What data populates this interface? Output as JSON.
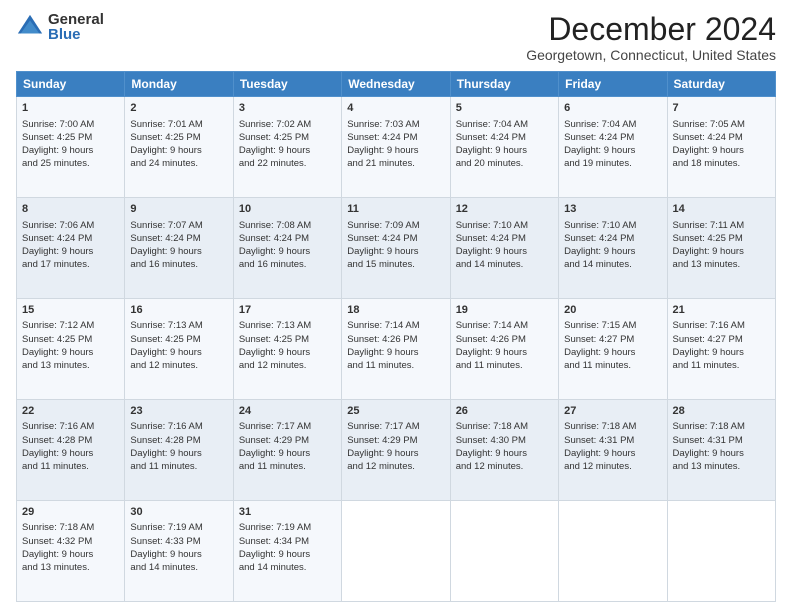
{
  "logo": {
    "general": "General",
    "blue": "Blue"
  },
  "title": "December 2024",
  "subtitle": "Georgetown, Connecticut, United States",
  "headers": [
    "Sunday",
    "Monday",
    "Tuesday",
    "Wednesday",
    "Thursday",
    "Friday",
    "Saturday"
  ],
  "weeks": [
    [
      {
        "day": "1",
        "lines": [
          "Sunrise: 7:00 AM",
          "Sunset: 4:25 PM",
          "Daylight: 9 hours",
          "and 25 minutes."
        ]
      },
      {
        "day": "2",
        "lines": [
          "Sunrise: 7:01 AM",
          "Sunset: 4:25 PM",
          "Daylight: 9 hours",
          "and 24 minutes."
        ]
      },
      {
        "day": "3",
        "lines": [
          "Sunrise: 7:02 AM",
          "Sunset: 4:25 PM",
          "Daylight: 9 hours",
          "and 22 minutes."
        ]
      },
      {
        "day": "4",
        "lines": [
          "Sunrise: 7:03 AM",
          "Sunset: 4:24 PM",
          "Daylight: 9 hours",
          "and 21 minutes."
        ]
      },
      {
        "day": "5",
        "lines": [
          "Sunrise: 7:04 AM",
          "Sunset: 4:24 PM",
          "Daylight: 9 hours",
          "and 20 minutes."
        ]
      },
      {
        "day": "6",
        "lines": [
          "Sunrise: 7:04 AM",
          "Sunset: 4:24 PM",
          "Daylight: 9 hours",
          "and 19 minutes."
        ]
      },
      {
        "day": "7",
        "lines": [
          "Sunrise: 7:05 AM",
          "Sunset: 4:24 PM",
          "Daylight: 9 hours",
          "and 18 minutes."
        ]
      }
    ],
    [
      {
        "day": "8",
        "lines": [
          "Sunrise: 7:06 AM",
          "Sunset: 4:24 PM",
          "Daylight: 9 hours",
          "and 17 minutes."
        ]
      },
      {
        "day": "9",
        "lines": [
          "Sunrise: 7:07 AM",
          "Sunset: 4:24 PM",
          "Daylight: 9 hours",
          "and 16 minutes."
        ]
      },
      {
        "day": "10",
        "lines": [
          "Sunrise: 7:08 AM",
          "Sunset: 4:24 PM",
          "Daylight: 9 hours",
          "and 16 minutes."
        ]
      },
      {
        "day": "11",
        "lines": [
          "Sunrise: 7:09 AM",
          "Sunset: 4:24 PM",
          "Daylight: 9 hours",
          "and 15 minutes."
        ]
      },
      {
        "day": "12",
        "lines": [
          "Sunrise: 7:10 AM",
          "Sunset: 4:24 PM",
          "Daylight: 9 hours",
          "and 14 minutes."
        ]
      },
      {
        "day": "13",
        "lines": [
          "Sunrise: 7:10 AM",
          "Sunset: 4:24 PM",
          "Daylight: 9 hours",
          "and 14 minutes."
        ]
      },
      {
        "day": "14",
        "lines": [
          "Sunrise: 7:11 AM",
          "Sunset: 4:25 PM",
          "Daylight: 9 hours",
          "and 13 minutes."
        ]
      }
    ],
    [
      {
        "day": "15",
        "lines": [
          "Sunrise: 7:12 AM",
          "Sunset: 4:25 PM",
          "Daylight: 9 hours",
          "and 13 minutes."
        ]
      },
      {
        "day": "16",
        "lines": [
          "Sunrise: 7:13 AM",
          "Sunset: 4:25 PM",
          "Daylight: 9 hours",
          "and 12 minutes."
        ]
      },
      {
        "day": "17",
        "lines": [
          "Sunrise: 7:13 AM",
          "Sunset: 4:25 PM",
          "Daylight: 9 hours",
          "and 12 minutes."
        ]
      },
      {
        "day": "18",
        "lines": [
          "Sunrise: 7:14 AM",
          "Sunset: 4:26 PM",
          "Daylight: 9 hours",
          "and 11 minutes."
        ]
      },
      {
        "day": "19",
        "lines": [
          "Sunrise: 7:14 AM",
          "Sunset: 4:26 PM",
          "Daylight: 9 hours",
          "and 11 minutes."
        ]
      },
      {
        "day": "20",
        "lines": [
          "Sunrise: 7:15 AM",
          "Sunset: 4:27 PM",
          "Daylight: 9 hours",
          "and 11 minutes."
        ]
      },
      {
        "day": "21",
        "lines": [
          "Sunrise: 7:16 AM",
          "Sunset: 4:27 PM",
          "Daylight: 9 hours",
          "and 11 minutes."
        ]
      }
    ],
    [
      {
        "day": "22",
        "lines": [
          "Sunrise: 7:16 AM",
          "Sunset: 4:28 PM",
          "Daylight: 9 hours",
          "and 11 minutes."
        ]
      },
      {
        "day": "23",
        "lines": [
          "Sunrise: 7:16 AM",
          "Sunset: 4:28 PM",
          "Daylight: 9 hours",
          "and 11 minutes."
        ]
      },
      {
        "day": "24",
        "lines": [
          "Sunrise: 7:17 AM",
          "Sunset: 4:29 PM",
          "Daylight: 9 hours",
          "and 11 minutes."
        ]
      },
      {
        "day": "25",
        "lines": [
          "Sunrise: 7:17 AM",
          "Sunset: 4:29 PM",
          "Daylight: 9 hours",
          "and 12 minutes."
        ]
      },
      {
        "day": "26",
        "lines": [
          "Sunrise: 7:18 AM",
          "Sunset: 4:30 PM",
          "Daylight: 9 hours",
          "and 12 minutes."
        ]
      },
      {
        "day": "27",
        "lines": [
          "Sunrise: 7:18 AM",
          "Sunset: 4:31 PM",
          "Daylight: 9 hours",
          "and 12 minutes."
        ]
      },
      {
        "day": "28",
        "lines": [
          "Sunrise: 7:18 AM",
          "Sunset: 4:31 PM",
          "Daylight: 9 hours",
          "and 13 minutes."
        ]
      }
    ],
    [
      {
        "day": "29",
        "lines": [
          "Sunrise: 7:18 AM",
          "Sunset: 4:32 PM",
          "Daylight: 9 hours",
          "and 13 minutes."
        ]
      },
      {
        "day": "30",
        "lines": [
          "Sunrise: 7:19 AM",
          "Sunset: 4:33 PM",
          "Daylight: 9 hours",
          "and 14 minutes."
        ]
      },
      {
        "day": "31",
        "lines": [
          "Sunrise: 7:19 AM",
          "Sunset: 4:34 PM",
          "Daylight: 9 hours",
          "and 14 minutes."
        ]
      },
      null,
      null,
      null,
      null
    ]
  ]
}
